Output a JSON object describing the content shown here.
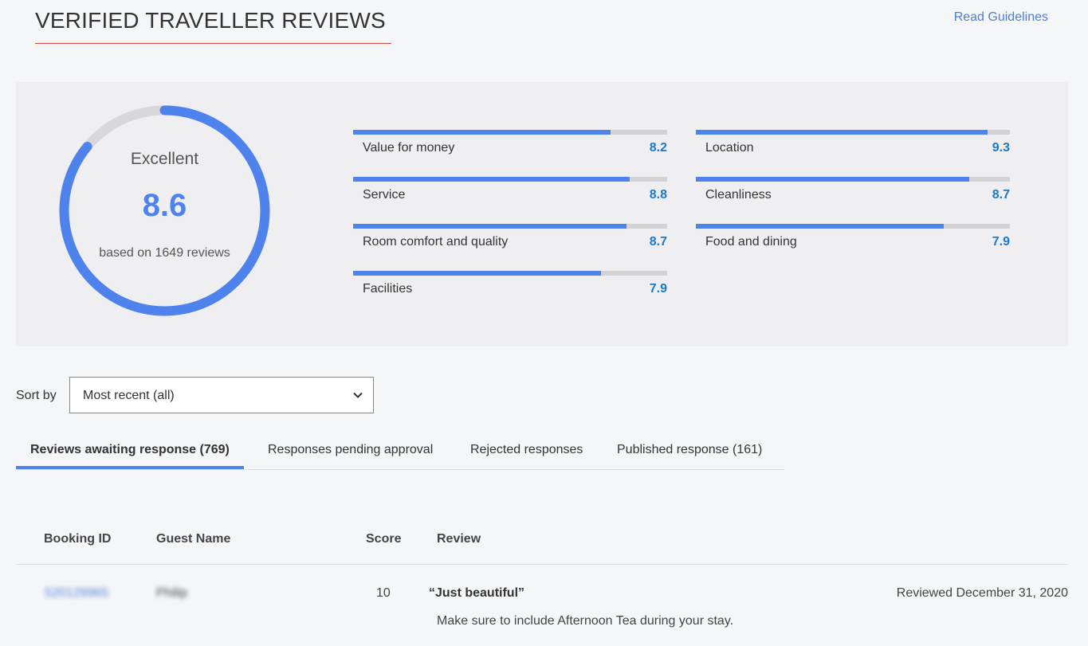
{
  "header": {
    "title": "VERIFIED TRAVELLER REVIEWS",
    "guidelines_link": "Read Guidelines"
  },
  "summary": {
    "label": "Excellent",
    "score": "8.6",
    "score_value": 8.6,
    "score_max": 10,
    "reviews_text": "based on 1649 reviews"
  },
  "categories": [
    {
      "name": "Value for money",
      "score": "8.2",
      "fraction": 0.82
    },
    {
      "name": "Location",
      "score": "9.3",
      "fraction": 0.93
    },
    {
      "name": "Service",
      "score": "8.8",
      "fraction": 0.88
    },
    {
      "name": "Cleanliness",
      "score": "8.7",
      "fraction": 0.87
    },
    {
      "name": "Room comfort and quality",
      "score": "8.7",
      "fraction": 0.87
    },
    {
      "name": "Food and dining",
      "score": "7.9",
      "fraction": 0.79
    },
    {
      "name": "Facilities",
      "score": "7.9",
      "fraction": 0.79
    }
  ],
  "sort": {
    "label": "Sort by",
    "selected": "Most recent (all)"
  },
  "tabs": [
    {
      "label": "Reviews awaiting response (769)",
      "active": true
    },
    {
      "label": "Responses pending approval",
      "active": false
    },
    {
      "label": "Rejected responses",
      "active": false
    },
    {
      "label": "Published response (161)",
      "active": false
    }
  ],
  "table": {
    "headers": {
      "booking_id": "Booking ID",
      "guest_name": "Guest Name",
      "score": "Score",
      "review": "Review"
    },
    "rows": [
      {
        "booking_id": "520129965",
        "guest_name": "Philip",
        "score": "10",
        "review_title": "“Just beautiful”",
        "review_body": "Make sure to include Afternoon Tea during your stay.",
        "reviewed_date": "Reviewed December 31, 2020"
      }
    ]
  },
  "colors": {
    "accent": "#4e82ec",
    "score_text": "#1a7ac9",
    "link": "#4a7fd6",
    "title_underline": "#d64545"
  }
}
